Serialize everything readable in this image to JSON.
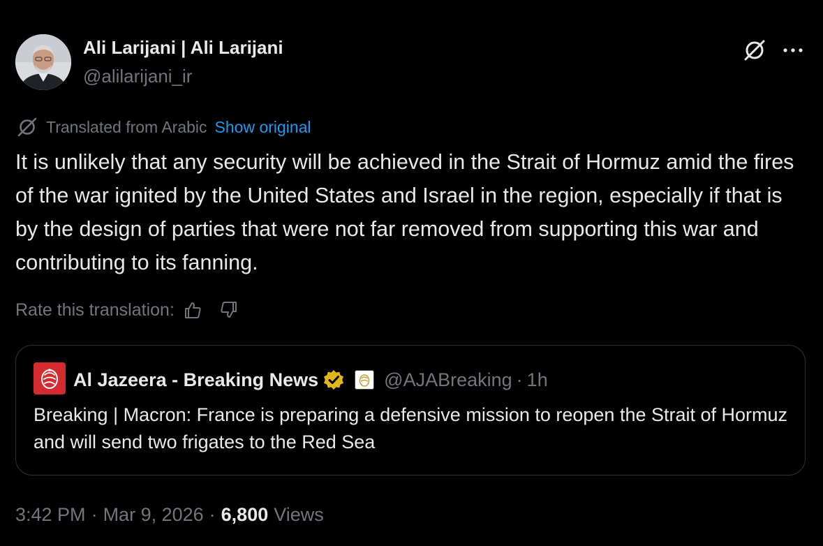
{
  "author": {
    "name": "Ali Larijani | Ali Larijani",
    "handle": "@alilarijani_ir",
    "avatar_icon": "profile-photo"
  },
  "header_actions": {
    "grok_icon": "grok-icon",
    "more_icon": "more-horizontal-icon"
  },
  "translation": {
    "notice": "Translated from Arabic",
    "show_original": "Show original",
    "rate_label": "Rate this translation:",
    "thumbs_up_icon": "thumbs-up-icon",
    "thumbs_down_icon": "thumbs-down-icon"
  },
  "tweet": {
    "text": "It is unlikely that any security will be achieved in the Strait of Hormuz amid the fires of the war ignited by the United States and Israel in the region, especially if that is by the design of parties that were not far removed from supporting this war and contributing to its fanning."
  },
  "quote": {
    "name": "Al Jazeera - Breaking News",
    "handle": "@AJABreaking",
    "separator": "·",
    "time": "1h",
    "text": "Breaking | Macron: France is preparing a defensive mission to reopen the Strait of Hormuz and will send two frigates to the Red Sea",
    "badge_icon": "verified-gold-badge-icon",
    "affiliate_icon": "al-jazeera-affiliate-icon",
    "brand_color": "#d32b2f"
  },
  "footer": {
    "time": "3:42 PM",
    "separator": "·",
    "date": "Mar 9, 2026",
    "views_count": "6,800",
    "views_label": "Views"
  },
  "colors": {
    "background": "#000000",
    "text": "#e7e9ea",
    "muted": "#71767b",
    "link": "#1d9bf0",
    "border": "#2f3336",
    "verified_gold": "#e2b719"
  }
}
